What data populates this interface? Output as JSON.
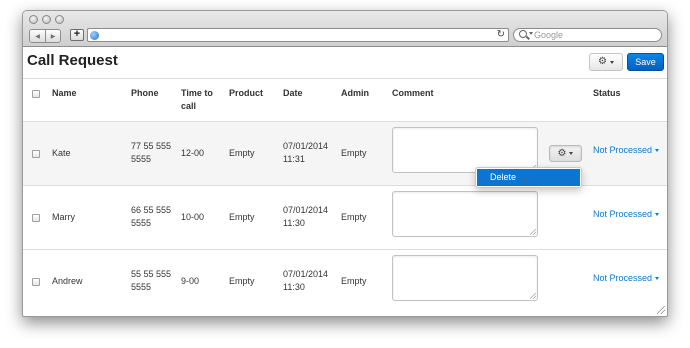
{
  "browser": {
    "search_placeholder": "Google"
  },
  "page": {
    "title": "Call Request",
    "save_label": "Save"
  },
  "table": {
    "headers": {
      "name": "Name",
      "phone": "Phone",
      "time_line1": "Time to",
      "time_line2": "call",
      "product": "Product",
      "date": "Date",
      "admin": "Admin",
      "comment": "Comment",
      "status": "Status"
    },
    "rows": [
      {
        "name": "Kate",
        "phone_line1": "77 55 555",
        "phone_line2": "5555",
        "time": "12-00",
        "product": "Empty",
        "date_line1": "07/01/2014",
        "date_line2": "11:31",
        "admin": "Empty",
        "status": "Not Processed"
      },
      {
        "name": "Marry",
        "phone_line1": "66 55 555",
        "phone_line2": "5555",
        "time": "10-00",
        "product": "Empty",
        "date_line1": "07/01/2014",
        "date_line2": "11:30",
        "admin": "Empty",
        "status": "Not Processed"
      },
      {
        "name": "Andrew",
        "phone_line1": "55 55 555",
        "phone_line2": "5555",
        "time": "9-00",
        "product": "Empty",
        "date_line1": "07/01/2014",
        "date_line2": "11:30",
        "admin": "Empty",
        "status": "Not Processed"
      }
    ]
  },
  "row_menu": {
    "delete_label": "Delete"
  },
  "colors": {
    "accent": "#0b7ad1",
    "save_button": "#0460c2",
    "menu_highlight": "#0d75cf"
  },
  "icons": [
    "back-arrow-icon",
    "forward-arrow-icon",
    "plus-icon",
    "globe-icon",
    "reload-icon",
    "search-icon",
    "gear-icon",
    "caret-down-icon",
    "resize-grip-icon"
  ]
}
